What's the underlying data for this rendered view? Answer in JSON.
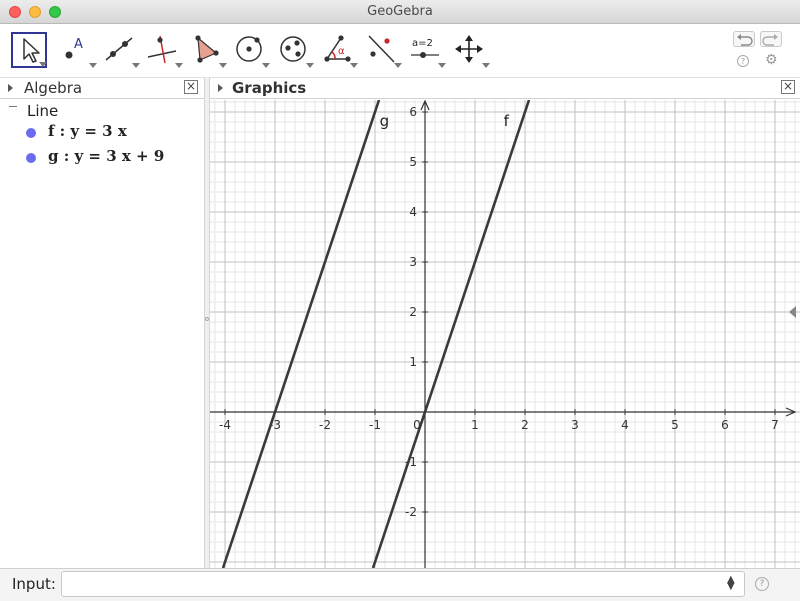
{
  "window": {
    "title": "GeoGebra"
  },
  "toolbar": {
    "tools": [
      {
        "name": "move-tool",
        "active": true
      },
      {
        "name": "point-tool",
        "label": "A"
      },
      {
        "name": "line-tool"
      },
      {
        "name": "perpendicular-line-tool"
      },
      {
        "name": "polygon-tool"
      },
      {
        "name": "circle-center-point-tool"
      },
      {
        "name": "circle-three-points-tool"
      },
      {
        "name": "angle-tool",
        "label": "α"
      },
      {
        "name": "reflect-tool"
      },
      {
        "name": "slider-tool",
        "label": "a=2"
      },
      {
        "name": "move-graphics-view-tool"
      }
    ],
    "help_glyph": "?",
    "gear_glyph": "⚙"
  },
  "algebra": {
    "header": "Algebra",
    "close_glyph": "×",
    "group": "Line",
    "items": [
      {
        "text": "f :  y = 3 x",
        "color": "#6b6bf0"
      },
      {
        "text": "g :  y = 3 x + 9",
        "color": "#6b6bf0"
      }
    ]
  },
  "graphics": {
    "header": "Graphics",
    "close_glyph": "×",
    "line_color": "#3a3a3a",
    "label_f": "f",
    "label_g": "g"
  },
  "chart_data": {
    "type": "line",
    "title": "",
    "xlabel": "",
    "ylabel": "",
    "xlim": [
      -4.3,
      7.8
    ],
    "ylim": [
      -3.1,
      6.2
    ],
    "grid": true,
    "x_ticks": [
      -4,
      -3,
      -2,
      -1,
      0,
      1,
      2,
      3,
      4,
      5,
      6,
      7
    ],
    "y_ticks": [
      -2,
      -1,
      1,
      2,
      3,
      4,
      5,
      6
    ],
    "series": [
      {
        "name": "f",
        "equation": "y = 3 x",
        "slope": 3,
        "intercept": 0
      },
      {
        "name": "g",
        "equation": "y = 3 x + 9",
        "slope": 3,
        "intercept": 9
      }
    ]
  },
  "input_bar": {
    "label": "Input:",
    "value": "",
    "placeholder": "",
    "spinner_glyph": "▲▼",
    "help_glyph": "?"
  }
}
